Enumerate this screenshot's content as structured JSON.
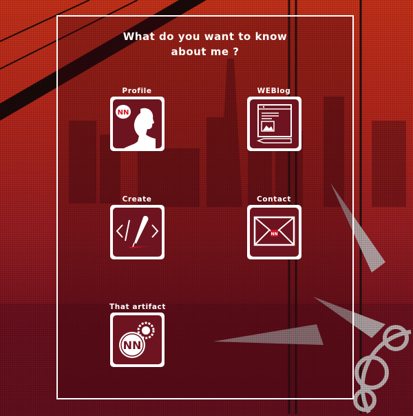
{
  "header": {
    "title_line1": "What do you want to know",
    "title_line2": "about me ?"
  },
  "items": [
    {
      "label": "Profile",
      "icon": "profile-silhouette-icon"
    },
    {
      "label": "WEBlog",
      "icon": "browser-window-icon"
    },
    {
      "label": "Create",
      "icon": "code-pen-icon"
    },
    {
      "label": "Contact",
      "icon": "envelope-icon"
    },
    {
      "label": "That artifact",
      "icon": "emblem-gear-icon"
    }
  ],
  "colors": {
    "accent": "#c8321a",
    "panel_border": "#ffffff",
    "icon_bg": "#6e1420",
    "logo_red": "#cc1122"
  }
}
